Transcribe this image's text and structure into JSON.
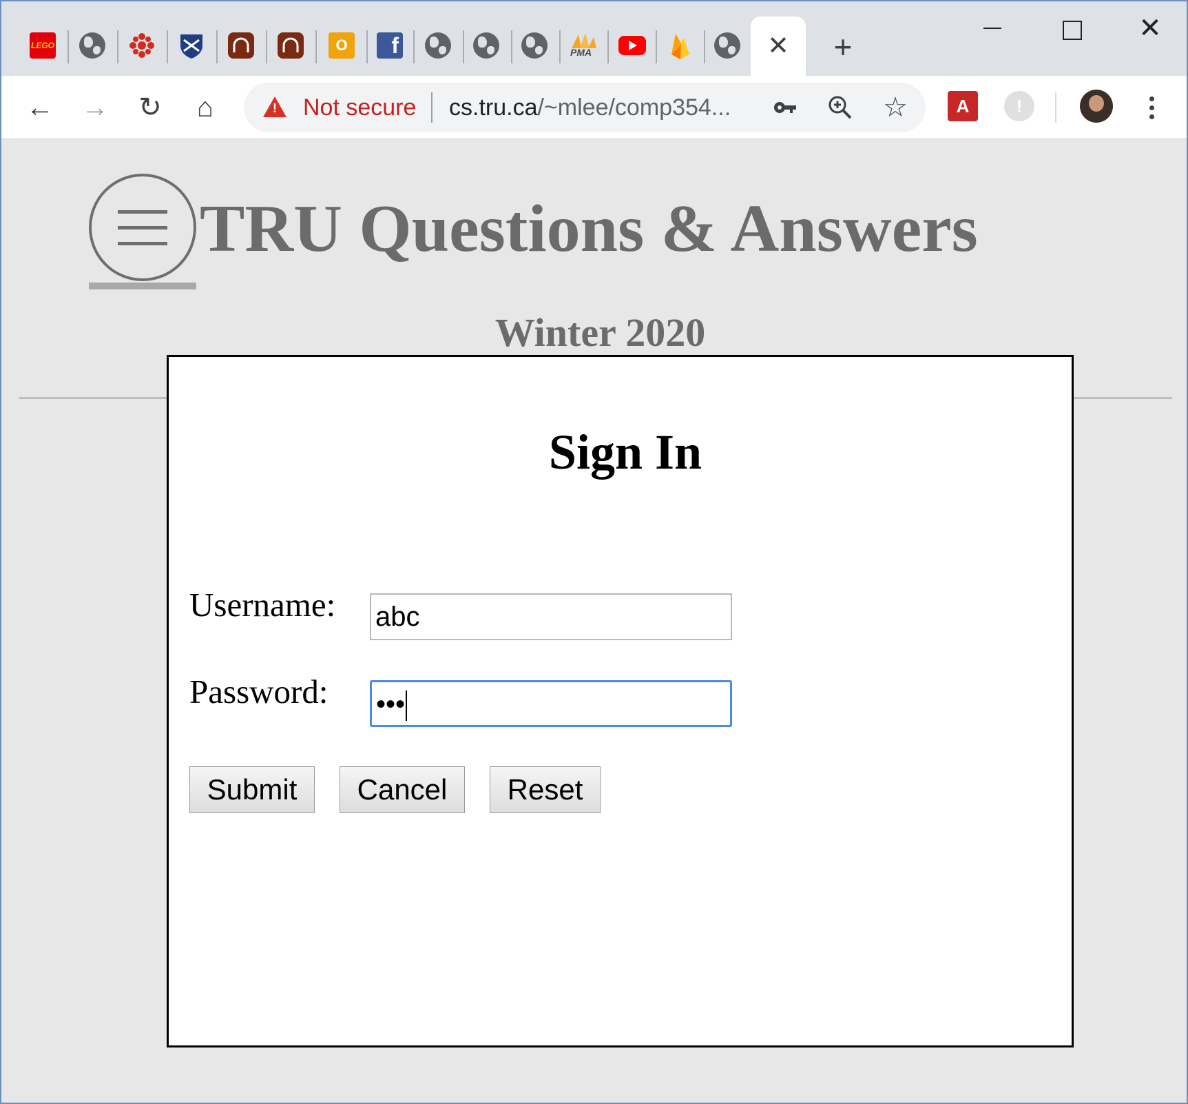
{
  "browser": {
    "tabs": [
      {
        "icon": "lego-icon",
        "label": "LEGO"
      },
      {
        "icon": "globe-icon"
      },
      {
        "icon": "cbc-icon"
      },
      {
        "icon": "university-shield-icon"
      },
      {
        "icon": "headphones-icon"
      },
      {
        "icon": "headphones-icon"
      },
      {
        "icon": "outlook-icon",
        "label": "O"
      },
      {
        "icon": "facebook-icon",
        "label": "f"
      },
      {
        "icon": "globe-icon"
      },
      {
        "icon": "globe-icon"
      },
      {
        "icon": "globe-icon"
      },
      {
        "icon": "pma-icon",
        "label": "PMA"
      },
      {
        "icon": "youtube-icon"
      },
      {
        "icon": "firebase-icon"
      },
      {
        "icon": "globe-icon"
      }
    ],
    "active_tab_close": "✕",
    "new_tab": "+",
    "window_close": "✕",
    "toolbar": {
      "back": "←",
      "forward": "→",
      "reload": "↻",
      "home": "⌂"
    },
    "omnibox": {
      "security_label": "Not secure",
      "url_host": "cs.tru.ca",
      "url_path": "/~mlee/comp354...",
      "key_icon": "key-icon",
      "zoom_icon": "zoom-in-icon",
      "star": "☆"
    },
    "extensions": {
      "ext1_label": "A",
      "ext2_label": "!"
    },
    "colors": {
      "warning": "#c5221f",
      "focus_ring": "#4a8ae6"
    }
  },
  "page": {
    "site_title": "TRU Questions & Answers",
    "term": "Winter 2020"
  },
  "signin": {
    "title": "Sign In",
    "username_label": "Username:",
    "username_value": "abc",
    "password_label": "Password:",
    "password_value": "•••",
    "buttons": {
      "submit": "Submit",
      "cancel": "Cancel",
      "reset": "Reset"
    }
  }
}
